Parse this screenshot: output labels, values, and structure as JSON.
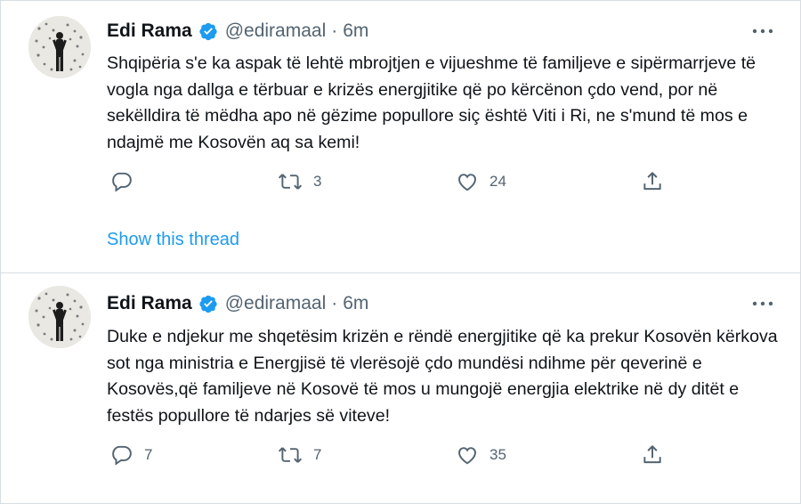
{
  "tweets": [
    {
      "author": "Edi Rama",
      "handle": "@ediramaal",
      "separator": "·",
      "time": "6m",
      "text": "Shqipëria s'e ka aspak të lehtë mbrojtjen e vijueshme të familjeve e sipërmarrjeve të vogla nga dallga e tërbuar e krizës energjitike që po kërcënon çdo vend, por në sekëlldira të mëdha apo në gëzime popullore siç është Viti i Ri, ne s'mund të mos e ndajmë me Kosovën aq sa kemi!",
      "replies": "",
      "retweets": "3",
      "likes": "24",
      "show_thread": "Show this thread"
    },
    {
      "author": "Edi Rama",
      "handle": "@ediramaal",
      "separator": "·",
      "time": "6m",
      "text": "Duke e ndjekur me shqetësim krizën e rëndë energjitike që ka prekur Kosovën kërkova sot nga ministria e Energjisë të vlerësojë çdo mundësi ndihme për qeverinë e Kosovës,që familjeve në Kosovë të mos u mungojë energjia elektrike në dy ditët e festës popullore të ndarjes së viteve!",
      "replies": "7",
      "retweets": "7",
      "likes": "35"
    }
  ],
  "icons": {
    "verified": "verified-badge-icon",
    "more": "more-icon",
    "reply": "reply-icon",
    "retweet": "retweet-icon",
    "like": "heart-icon",
    "share": "share-icon"
  },
  "colors": {
    "text": "#0f1419",
    "secondary": "#536471",
    "accent": "#1d9bf0",
    "border": "#d7dde2"
  }
}
